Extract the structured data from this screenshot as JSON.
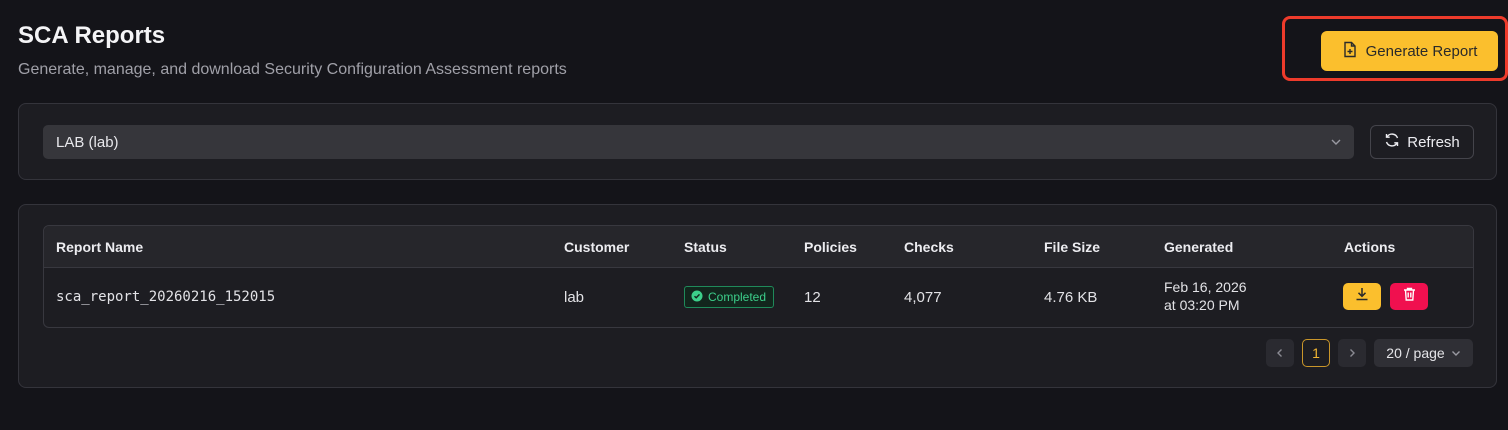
{
  "header": {
    "title": "SCA Reports",
    "subtitle": "Generate, manage, and download Security Configuration Assessment reports",
    "generate_label": "Generate Report"
  },
  "filter": {
    "selected_customer": "LAB (lab)",
    "refresh_label": "Refresh"
  },
  "table": {
    "columns": [
      "Report Name",
      "Customer",
      "Status",
      "Policies",
      "Checks",
      "File Size",
      "Generated",
      "Actions"
    ],
    "rows": [
      {
        "report_name": "sca_report_20260216_152015",
        "customer": "lab",
        "status": "Completed",
        "policies": "12",
        "checks": "4,077",
        "file_size": "4.76 KB",
        "generated_date": "Feb 16, 2026",
        "generated_time": "at 03:20 PM"
      }
    ]
  },
  "pagination": {
    "current_page": "1",
    "page_size": "20 / page"
  },
  "icons": [
    "file-plus-icon",
    "chevron-down-icon",
    "refresh-icon",
    "check-circle-icon",
    "download-icon",
    "trash-icon",
    "chevron-left-icon",
    "chevron-right-icon"
  ],
  "colors": {
    "accent": "#fbbf2d",
    "danger": "#f0104f",
    "success": "#3ccf8a",
    "highlight": "#ee3b2b",
    "background": "#141419"
  }
}
